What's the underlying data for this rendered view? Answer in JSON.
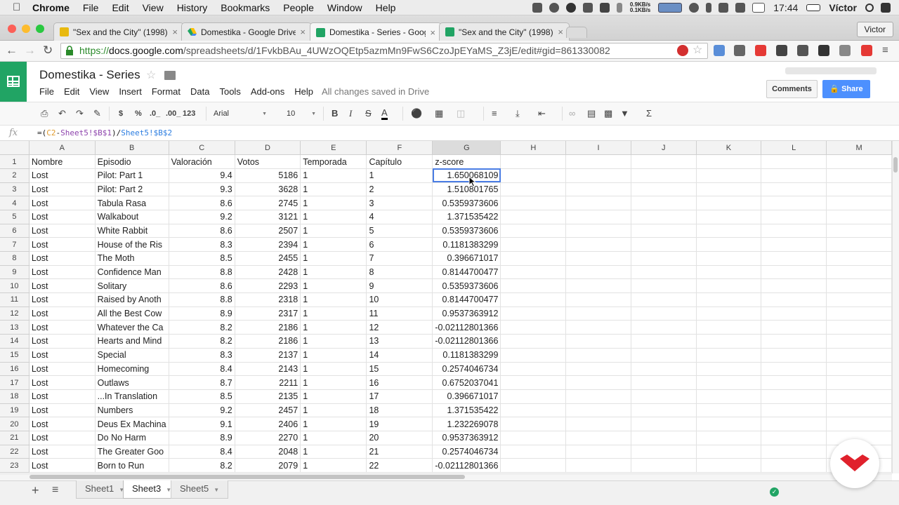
{
  "menubar": {
    "app": "Chrome",
    "items": [
      "File",
      "Edit",
      "View",
      "History",
      "Bookmarks",
      "People",
      "Window",
      "Help"
    ],
    "net_up": "0.9KB/s",
    "net_down": "0.1KB/s",
    "time": "17:44",
    "user": "Víctor"
  },
  "tabs": [
    {
      "title": "\"Sex and the City\" (1998)",
      "icon": "imdb-icon"
    },
    {
      "title": "Domestika - Google Drive",
      "icon": "drive-icon"
    },
    {
      "title": "Domestika - Series - Goog",
      "icon": "sheets-icon",
      "active": true
    },
    {
      "title": "\"Sex and the City\" (1998)",
      "icon": "sheets-icon"
    }
  ],
  "profile_button": "Victor",
  "omnibox": {
    "scheme": "https://",
    "host": "docs.google.com",
    "path": "/spreadsheets/d/1FvkbBAu_4UWzOQEtp5azmMn9FwS6CzoJpEYaMS_Z3jE/edit#gid=861330082"
  },
  "doc": {
    "title": "Domestika - Series",
    "menus": [
      "File",
      "Edit",
      "View",
      "Insert",
      "Format",
      "Data",
      "Tools",
      "Add-ons",
      "Help"
    ],
    "save_status": "All changes saved in Drive",
    "comments_label": "Comments",
    "share_label": "Share"
  },
  "toolbar": {
    "currency": "$",
    "percent": "%",
    "dec_less": ".0_",
    "dec_more": ".00_",
    "number_format": "123",
    "font": "Arial",
    "size": "10",
    "bold": "B",
    "italic": "I",
    "strike": "S",
    "text_color": "A",
    "functions": "Σ"
  },
  "formula_bar": {
    "fx": "fx",
    "p1": "=(",
    "p2": "C2",
    "p3": "-",
    "p4": "Sheet5!$B$1",
    "p5": ")/",
    "p6": "Sheet5!$B$2"
  },
  "grid": {
    "columns": [
      "A",
      "B",
      "C",
      "D",
      "E",
      "F",
      "G",
      "H",
      "I",
      "J",
      "K",
      "L",
      "M"
    ],
    "selected_column": "G",
    "header": [
      "Nombre",
      "Episodio",
      "Valoración",
      "Votos",
      "Temporada",
      "Capítulo",
      "z-score"
    ],
    "rows": [
      [
        "Lost",
        "Pilot: Part 1",
        "9.4",
        "5186",
        "1",
        "1",
        "1.650068109"
      ],
      [
        "Lost",
        "Pilot: Part 2",
        "9.3",
        "3628",
        "1",
        "2",
        "1.510801765"
      ],
      [
        "Lost",
        "Tabula Rasa",
        "8.6",
        "2745",
        "1",
        "3",
        "0.5359373606"
      ],
      [
        "Lost",
        "Walkabout",
        "9.2",
        "3121",
        "1",
        "4",
        "1.371535422"
      ],
      [
        "Lost",
        "White Rabbit",
        "8.6",
        "2507",
        "1",
        "5",
        "0.5359373606"
      ],
      [
        "Lost",
        "House of the Ris",
        "8.3",
        "2394",
        "1",
        "6",
        "0.1181383299"
      ],
      [
        "Lost",
        "The Moth",
        "8.5",
        "2455",
        "1",
        "7",
        "0.396671017"
      ],
      [
        "Lost",
        "Confidence Man",
        "8.8",
        "2428",
        "1",
        "8",
        "0.8144700477"
      ],
      [
        "Lost",
        "Solitary",
        "8.6",
        "2293",
        "1",
        "9",
        "0.5359373606"
      ],
      [
        "Lost",
        "Raised by Anoth",
        "8.8",
        "2318",
        "1",
        "10",
        "0.8144700477"
      ],
      [
        "Lost",
        "All the Best Cow",
        "8.9",
        "2317",
        "1",
        "11",
        "0.9537363912"
      ],
      [
        "Lost",
        "Whatever the Ca",
        "8.2",
        "2186",
        "1",
        "12",
        "-0.02112801366"
      ],
      [
        "Lost",
        "Hearts and Mind",
        "8.2",
        "2186",
        "1",
        "13",
        "-0.02112801366"
      ],
      [
        "Lost",
        "Special",
        "8.3",
        "2137",
        "1",
        "14",
        "0.1181383299"
      ],
      [
        "Lost",
        "Homecoming",
        "8.4",
        "2143",
        "1",
        "15",
        "0.2574046734"
      ],
      [
        "Lost",
        "Outlaws",
        "8.7",
        "2211",
        "1",
        "16",
        "0.6752037041"
      ],
      [
        "Lost",
        "...In Translation",
        "8.5",
        "2135",
        "1",
        "17",
        "0.396671017"
      ],
      [
        "Lost",
        "Numbers",
        "9.2",
        "2457",
        "1",
        "18",
        "1.371535422"
      ],
      [
        "Lost",
        "Deus Ex Machina",
        "9.1",
        "2406",
        "1",
        "19",
        "1.232269078"
      ],
      [
        "Lost",
        "Do No Harm",
        "8.9",
        "2270",
        "1",
        "20",
        "0.9537363912"
      ],
      [
        "Lost",
        "The Greater Goo",
        "8.4",
        "2048",
        "1",
        "21",
        "0.2574046734"
      ],
      [
        "Lost",
        "Born to Run",
        "8.2",
        "2079",
        "1",
        "22",
        "-0.02112801366"
      ]
    ]
  },
  "sheets": [
    {
      "name": "Sheet1"
    },
    {
      "name": "Sheet3",
      "active": true
    },
    {
      "name": "Sheet5"
    }
  ],
  "colors": {
    "sheets_green": "#21a464",
    "share_blue": "#4d90fe",
    "selection_blue": "#4a7de4",
    "domestika_red": "#e0212c"
  }
}
